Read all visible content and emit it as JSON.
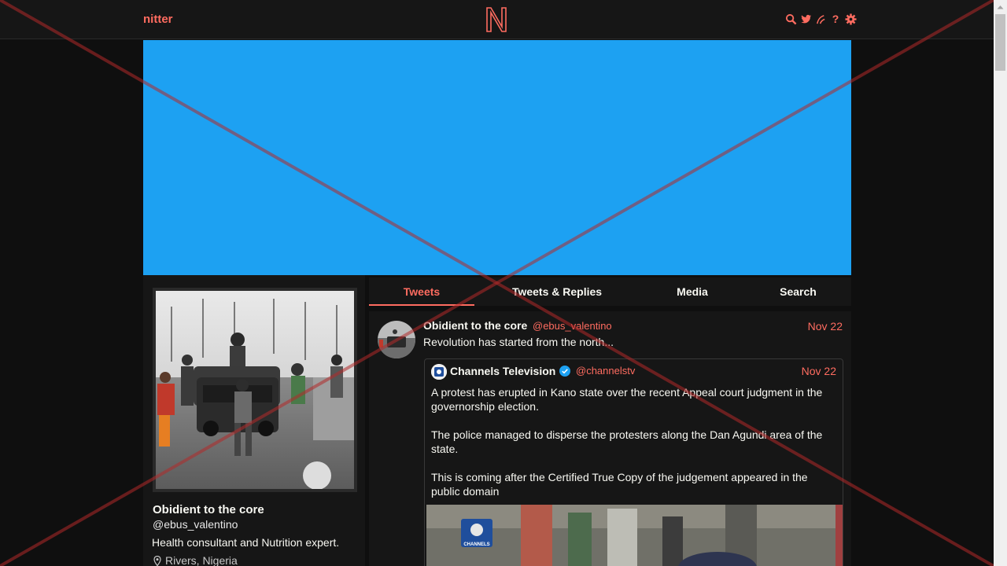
{
  "navbar": {
    "brand": "nitter",
    "logo": "N",
    "icons": [
      "search-icon",
      "twitter-icon",
      "rss-icon",
      "help-icon",
      "settings-icon"
    ],
    "help_glyph": "?"
  },
  "colors": {
    "accent": "#ff6c60",
    "banner": "#1da1f2",
    "background": "#0f0f0f",
    "panel": "#161616",
    "verified": "#1da1f2"
  },
  "profile": {
    "fullname": "Obidient to the core",
    "username": "@ebus_valentino",
    "bio": "Health consultant and Nutrition expert.",
    "location": "Rivers, Nigeria"
  },
  "tabs": [
    {
      "label": "Tweets",
      "active": true
    },
    {
      "label": "Tweets & Replies",
      "active": false
    },
    {
      "label": "Media",
      "active": false
    },
    {
      "label": "Search",
      "active": false
    }
  ],
  "tweet": {
    "fullname": "Obidient to the core",
    "username": "@ebus_valentino",
    "date": "Nov 22",
    "text": "Revolution has started from the north...",
    "quote": {
      "fullname": "Channels Television",
      "username": "@channelstv",
      "verified": true,
      "date": "Nov 22",
      "paragraphs": [
        "A protest has erupted in Kano state over the recent Appeal court judgment in the governorship election.",
        "The police managed to disperse the protesters along the Dan Agundi area of the state.",
        "This is coming after the Certified True Copy of the judgement appeared in the public domain"
      ],
      "media_watermark": "CHANNELS"
    }
  }
}
